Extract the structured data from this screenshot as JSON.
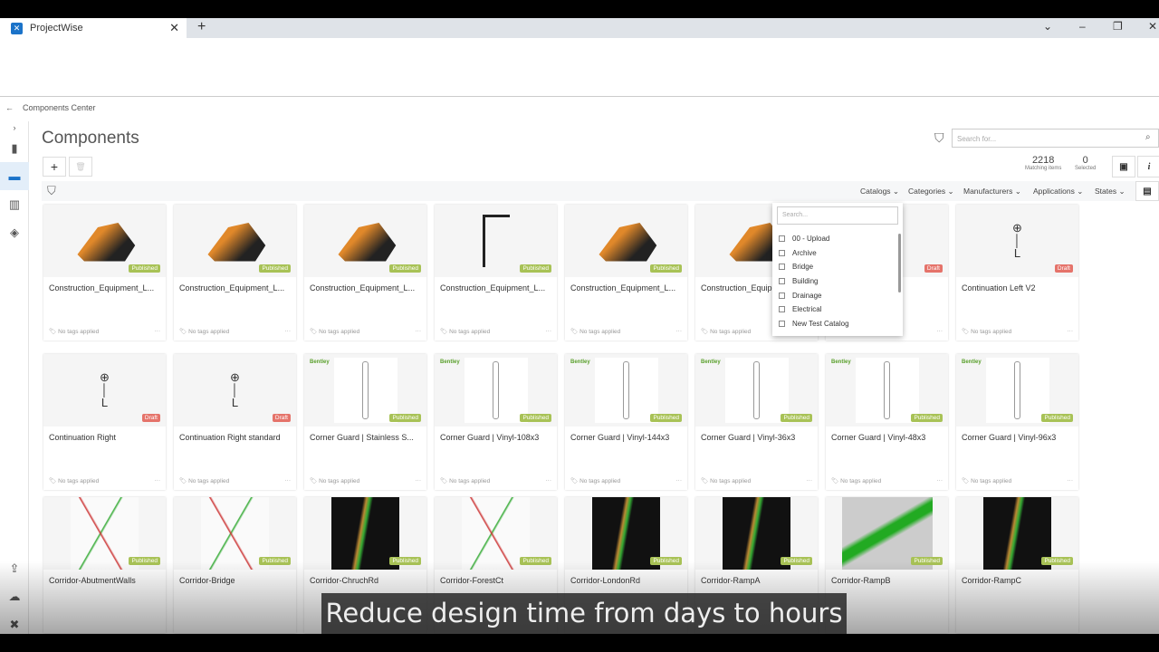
{
  "browser": {
    "tab_title": "ProjectWise",
    "new_tab": "+",
    "close": "✕"
  },
  "breadcrumb": {
    "back": "←",
    "label": "Components Center"
  },
  "page": {
    "title": "Components",
    "add": "+",
    "delete": "🗑"
  },
  "search": {
    "placeholder": "Search for..."
  },
  "stats": {
    "matching": "2218",
    "matching_label": "Matching items",
    "selected": "0",
    "selected_label": "Selected"
  },
  "filters": [
    "Catalogs",
    "Categories",
    "Manufacturers",
    "Applications",
    "States"
  ],
  "catalog_dropdown": {
    "placeholder": "Search...",
    "options": [
      "00 - Upload",
      "Archive",
      "Bridge",
      "Building",
      "Drainage",
      "Electrical",
      "New Test Catalog"
    ]
  },
  "tags_text": "No tags applied",
  "more": "···",
  "colors": {
    "published": "#a8c256",
    "draft": "#e5736a",
    "accent": "#1b73c9"
  },
  "cards": [
    {
      "name": "Construction_Equipment_L...",
      "state": "Published",
      "kind": "equip"
    },
    {
      "name": "Construction_Equipment_L...",
      "state": "Published",
      "kind": "equip"
    },
    {
      "name": "Construction_Equipment_L...",
      "state": "Published",
      "kind": "equip"
    },
    {
      "name": "Construction_Equipment_L...",
      "state": "Published",
      "kind": "crane"
    },
    {
      "name": "Construction_Equipment_L...",
      "state": "Published",
      "kind": "equip"
    },
    {
      "name": "Construction_Equipment_L...",
      "state": "Published",
      "kind": "equip"
    },
    {
      "name": "",
      "state": "Draft",
      "kind": "blank"
    },
    {
      "name": "Continuation Left V2",
      "state": "Draft",
      "kind": "symbol"
    },
    {
      "name": "Continuation Right",
      "state": "Draft",
      "kind": "symbol"
    },
    {
      "name": "Continuation Right standard",
      "state": "Draft",
      "kind": "symbol"
    },
    {
      "name": "Corner Guard | Stainless S...",
      "state": "Published",
      "kind": "guard",
      "brand": "Bentley"
    },
    {
      "name": "Corner Guard | Vinyl-108x3",
      "state": "Published",
      "kind": "guard",
      "brand": "Bentley"
    },
    {
      "name": "Corner Guard | Vinyl-144x3",
      "state": "Published",
      "kind": "guard",
      "brand": "Bentley"
    },
    {
      "name": "Corner Guard | Vinyl-36x3",
      "state": "Published",
      "kind": "guard",
      "brand": "Bentley"
    },
    {
      "name": "Corner Guard | Vinyl-48x3",
      "state": "Published",
      "kind": "guard",
      "brand": "Bentley"
    },
    {
      "name": "Corner Guard | Vinyl-96x3",
      "state": "Published",
      "kind": "guard",
      "brand": "Bentley"
    },
    {
      "name": "Corridor-AbutmentWalls",
      "state": "Published",
      "kind": "plan"
    },
    {
      "name": "Corridor-Bridge",
      "state": "Published",
      "kind": "plan"
    },
    {
      "name": "Corridor-ChruchRd",
      "state": "Published",
      "kind": "dark"
    },
    {
      "name": "Corridor-ForestCt",
      "state": "Published",
      "kind": "plan"
    },
    {
      "name": "Corridor-LondonRd",
      "state": "Published",
      "kind": "dark"
    },
    {
      "name": "Corridor-RampA",
      "state": "Published",
      "kind": "dark"
    },
    {
      "name": "Corridor-RampB",
      "state": "Published",
      "kind": "green"
    },
    {
      "name": "Corridor-RampC",
      "state": "Published",
      "kind": "dark"
    }
  ],
  "caption": "Reduce design time from days to hours"
}
